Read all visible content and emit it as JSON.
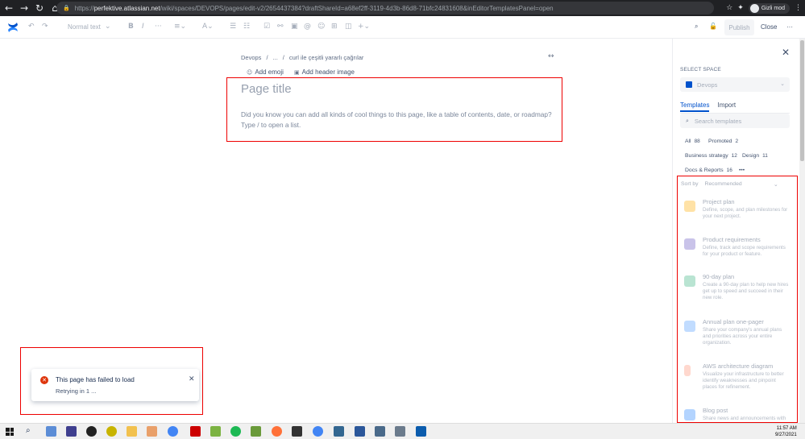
{
  "browser": {
    "url_host": "perfektive.atlassian.net",
    "url_prefix": "https://",
    "url_path": "/wiki/spaces/DEVOPS/pages/edit-v2/2654437384?draftShareId=a68ef2ff-3119-4d3b-86d8-71bfc24831608&inEditorTemplatesPanel=open",
    "profile_label": "Gizli mod"
  },
  "toolbar": {
    "text_style": "Normal text",
    "publish_label": "Publish",
    "close_label": "Close"
  },
  "editor": {
    "breadcrumb": [
      "Devops",
      "/",
      "...",
      "/",
      "curl ile çeşitli yararlı çağrılar"
    ],
    "add_emoji_label": "Add emoji",
    "add_header_image_label": "Add header image",
    "title_placeholder": "Page title",
    "hint_text": "Did you know you can add all kinds of cool things to this page, like a table of contents, date, or roadmap? Type / to open a list."
  },
  "toast": {
    "title": "This page has failed to load",
    "subtitle": "Retrying in 1 ..."
  },
  "panel": {
    "select_space_label": "SELECT SPACE",
    "selected_space": "Devops",
    "tabs": [
      {
        "label": "Templates",
        "active": true
      },
      {
        "label": "Import",
        "active": false
      }
    ],
    "search_placeholder": "Search templates",
    "categories": [
      {
        "label": "All",
        "count": "88"
      },
      {
        "label": "Promoted",
        "count": "2"
      },
      {
        "label": "Business strategy",
        "count": "12"
      },
      {
        "label": "Design",
        "count": "11"
      },
      {
        "label": "Docs & Reports",
        "count": "16"
      }
    ],
    "more_label": "•••",
    "sort_label": "Sort by",
    "sort_value": "Recommended",
    "templates": [
      {
        "name": "Project plan",
        "desc": "Define, scope, and plan milestones for your next project.",
        "color": "#ffab00"
      },
      {
        "name": "Product requirements",
        "desc": "Define, track and scope requirements for your product or feature.",
        "color": "#6554c0"
      },
      {
        "name": "90-day plan",
        "desc": "Create a 90-day plan to help new hires get up to speed and succeed in their new role.",
        "color": "#36b37e"
      },
      {
        "name": "Annual plan one-pager",
        "desc": "Share your company's annual plans and priorities across your entire organization.",
        "color": "#4c9aff"
      },
      {
        "name": "AWS architecture diagram",
        "desc": "Visualize your infrastructure to better identify weaknesses and pinpoint places for refinement.",
        "color": "#ff8f73"
      },
      {
        "name": "Blog post",
        "desc": "Share news and announcements with",
        "color": "#2684ff"
      }
    ]
  },
  "taskbar": {
    "time": "11:57 AM",
    "date": "9/27/2021"
  }
}
